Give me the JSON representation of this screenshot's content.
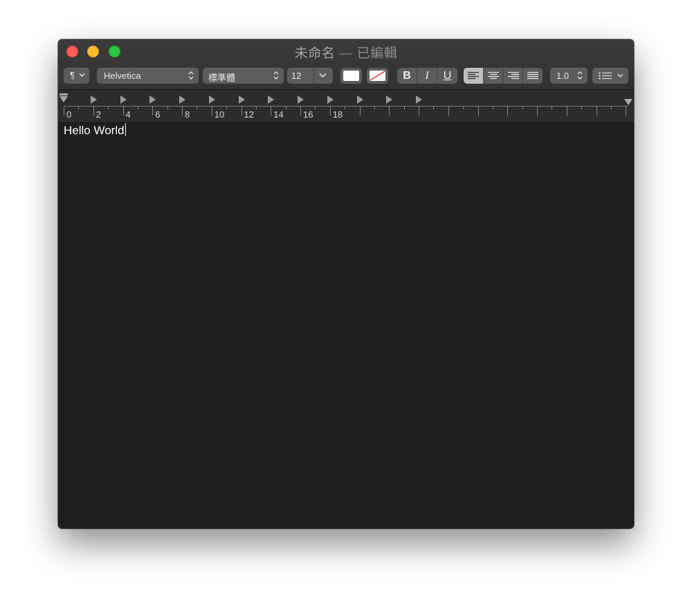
{
  "window": {
    "title": "未命名",
    "title_separator": "—",
    "title_status": "已編輯"
  },
  "toolbar": {
    "paragraph_style_icon": "¶",
    "font_family": "Helvetica",
    "font_style": "標準體",
    "font_size": "12",
    "text_color": "#ffffff",
    "background_color": "none",
    "bold_label": "B",
    "italic_label": "I",
    "underline_label": "U",
    "alignment": [
      "left",
      "center",
      "right",
      "justify"
    ],
    "selected_alignment": "left",
    "line_spacing": "1.0",
    "list_icon": "list-bullets-icon"
  },
  "ruler": {
    "labels": [
      "0",
      "2",
      "4",
      "6",
      "8",
      "10",
      "12",
      "14",
      "16",
      "18"
    ]
  },
  "document": {
    "text": "Hello World"
  },
  "colors": {
    "close": "#fe5f57",
    "minimize": "#febb2e",
    "maximize": "#29c840"
  }
}
